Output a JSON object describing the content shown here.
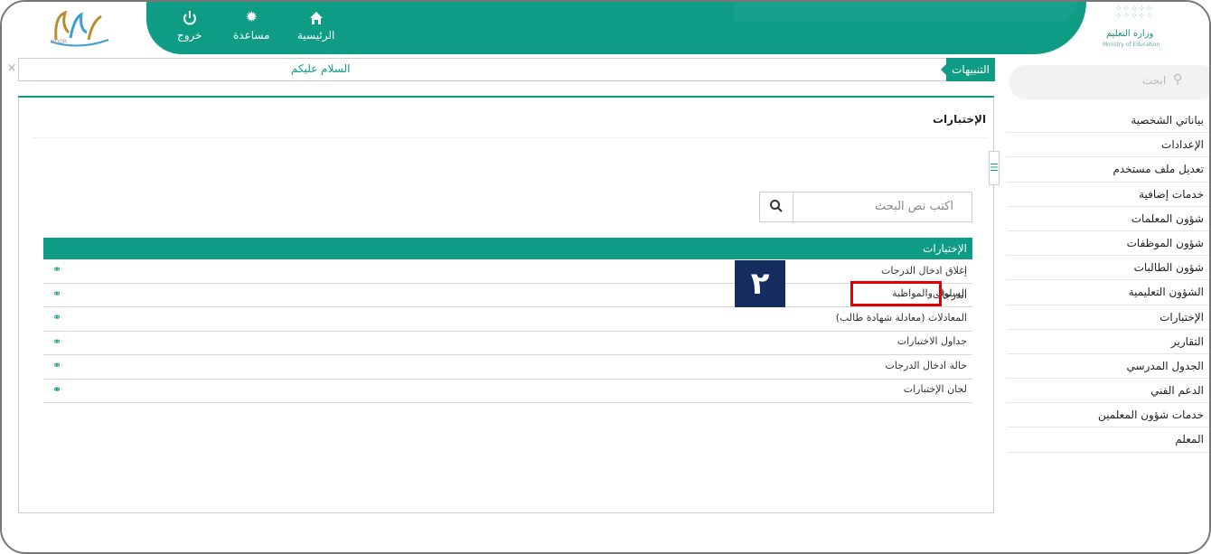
{
  "topbar": {
    "noor_logo_text": "NOOR",
    "nav": [
      {
        "label": "خروج",
        "icon": "power-icon"
      },
      {
        "label": "مساعدة",
        "icon": "gear-icon"
      },
      {
        "label": "الرئيسية",
        "icon": "home-icon"
      }
    ],
    "ministry": {
      "name_ar": "وزارة التعليم",
      "name_en": "Ministry of Education"
    }
  },
  "alerts": {
    "tag": "التنبيهات",
    "message": "السلام عليكم",
    "close": "×"
  },
  "sidebar": {
    "search_placeholder": "ابحث",
    "items": [
      {
        "label": "بياناتي الشخصية"
      },
      {
        "label": "الإعدادات"
      },
      {
        "label": "تعديل ملف مستخدم"
      },
      {
        "label": "خدمات إضافية"
      },
      {
        "label": "شؤون المعلمات"
      },
      {
        "label": "شؤون الموظفات"
      },
      {
        "label": "شؤون الطالبات"
      },
      {
        "label": "الشؤون التعليمية"
      },
      {
        "label": "الإختبارات"
      },
      {
        "label": "التقارير"
      },
      {
        "label": "الجدول المدرسي"
      },
      {
        "label": "الدعم الفني"
      },
      {
        "label": "خدمات شؤون المعلمين"
      },
      {
        "label": "المعلم"
      }
    ]
  },
  "main": {
    "title": "الإختبارات",
    "search_placeholder": "اكتب نص البحث",
    "table_header": "الإختبارات",
    "rows": [
      {
        "label": "إغلاق ادخال الدرجات"
      },
      {
        "label": "الدرجات"
      },
      {
        "label": "السلوك والمواظبة"
      },
      {
        "label": "المعادلات (معادلة شهادة طالب)"
      },
      {
        "label": "جداول الاختبارات"
      },
      {
        "label": "حالة ادخال الدرجات"
      },
      {
        "label": "لجان الإختبارات"
      }
    ],
    "step_badge": "٢"
  },
  "colors": {
    "accent": "#0f9c85",
    "highlight": "#e30000",
    "badge": "#142d5e"
  }
}
